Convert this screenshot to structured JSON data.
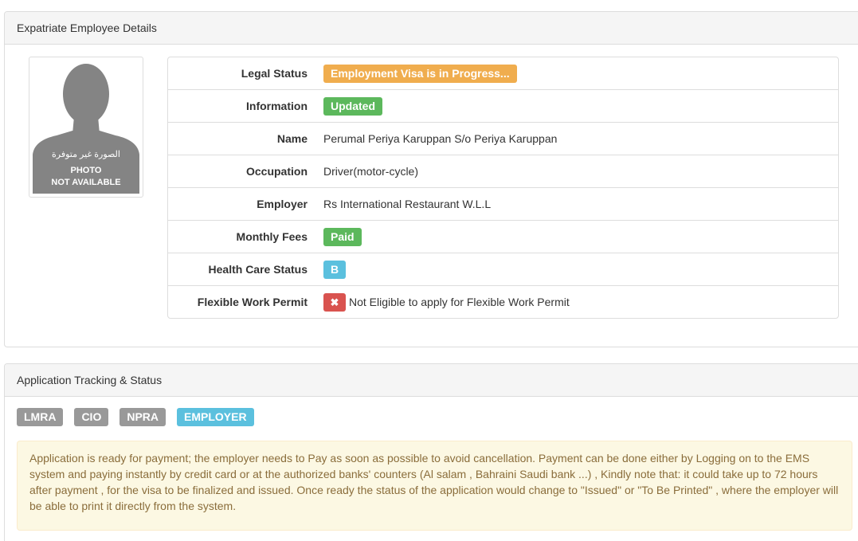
{
  "details_panel": {
    "title": "Expatriate Employee Details",
    "photo": {
      "arabic_text": "الصورة غير متوفرة",
      "line1": "PHOTO",
      "line2": "NOT AVAILABLE"
    },
    "rows": [
      {
        "label": "Legal Status",
        "badge": "Employment Visa is in Progress...",
        "badge_color": "#f0ad4e"
      },
      {
        "label": "Information",
        "badge": "Updated",
        "badge_color": "#5cb85c"
      },
      {
        "label": "Name",
        "value": "Perumal Periya Karuppan S/o Periya Karuppan"
      },
      {
        "label": "Occupation",
        "value": "Driver(motor-cycle)"
      },
      {
        "label": "Employer",
        "value": "Rs International Restaurant W.L.L"
      },
      {
        "label": "Monthly Fees",
        "badge": "Paid",
        "badge_color": "#5cb85c"
      },
      {
        "label": "Health Care Status",
        "badge": "B",
        "badge_color": "#5bc0de"
      },
      {
        "label": "Flexible Work Permit",
        "icon": "x-icon",
        "value": "Not Eligible to apply for Flexible Work Permit",
        "icon_color": "#d9534f"
      }
    ]
  },
  "tracking_panel": {
    "title": "Application Tracking & Status",
    "tags": [
      {
        "label": "LMRA",
        "color": "#999999"
      },
      {
        "label": "CIO",
        "color": "#999999"
      },
      {
        "label": "NPRA",
        "color": "#999999"
      },
      {
        "label": "EMPLOYER",
        "color": "#5bc0de"
      }
    ],
    "message": "Application is ready for payment; the employer needs to Pay as soon as possible to avoid cancellation. Payment can be done either by Logging on to the EMS system and paying instantly by credit card or at the authorized banks' counters (Al salam , Bahraini Saudi bank ...) , Kindly note that: it could take up to 72 hours after payment , for the visa to be finalized and issued. Once ready the status of the application would change to \"Issued\" or \"To Be Printed\" , where the employer will be able to print it directly from the system."
  }
}
